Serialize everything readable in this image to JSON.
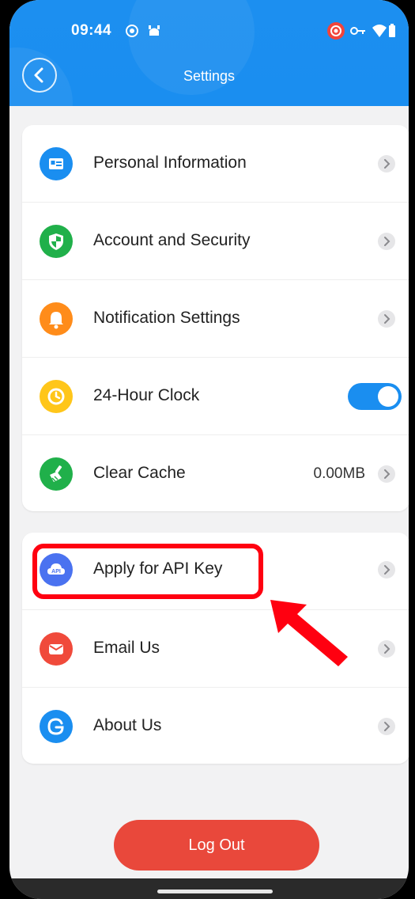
{
  "status_bar": {
    "time": "09:44"
  },
  "header": {
    "title": "Settings"
  },
  "settings_group1": [
    {
      "label": "Personal Information",
      "icon": "id-card-icon",
      "color": "#1a8ef0"
    },
    {
      "label": "Account and Security",
      "icon": "shield-icon",
      "color": "#20b04a"
    },
    {
      "label": "Notification Settings",
      "icon": "bell-icon",
      "color": "#ff8c1a"
    },
    {
      "label": "24-Hour Clock",
      "icon": "clock-icon",
      "color": "#ffc61a",
      "toggle": true
    },
    {
      "label": "Clear Cache",
      "icon": "broom-icon",
      "color": "#20b04a",
      "value": "0.00MB"
    }
  ],
  "settings_group2": [
    {
      "label": "Apply for API Key",
      "icon": "api-cloud-icon",
      "color": "#4a72f0"
    },
    {
      "label": "Email Us",
      "icon": "mail-icon",
      "color": "#f04a3b"
    },
    {
      "label": "About Us",
      "icon": "logo-icon",
      "color": "#1a8ef0"
    }
  ],
  "logout_label": "Log Out",
  "colors": {
    "accent": "#1a8ef0",
    "danger": "#e9483b",
    "highlight": "#ff0010"
  }
}
